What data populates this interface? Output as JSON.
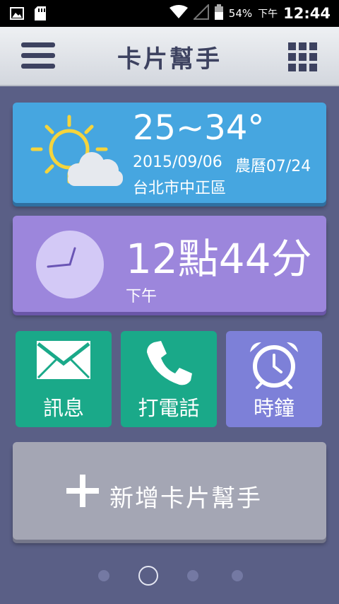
{
  "status_bar": {
    "battery": "54%",
    "ampm": "下午",
    "time": "12:44"
  },
  "header": {
    "title": "卡片幫手"
  },
  "weather": {
    "temperature": "25~34°",
    "date": "2015/09/06",
    "lunar": "農曆07/24",
    "location": "台北市中正區",
    "icon": "partly-sunny-icon"
  },
  "clock": {
    "time": "12點44分",
    "period": "下午",
    "icon": "clock-icon"
  },
  "shortcuts": [
    {
      "label": "訊息",
      "icon": "envelope-icon",
      "color": "#1aa989"
    },
    {
      "label": "打電話",
      "icon": "phone-icon",
      "color": "#1aa989"
    },
    {
      "label": "時鐘",
      "icon": "alarm-clock-icon",
      "color": "#7d80d8"
    }
  ],
  "add_card": {
    "label": "新增卡片幫手",
    "icon": "plus-icon"
  },
  "pager": {
    "total": 4,
    "active_index": 1
  },
  "colors": {
    "background": "#5a5f86",
    "weather_card": "#46a6e0",
    "clock_card": "#9c86dc",
    "shortcut_green": "#1aa989",
    "shortcut_purple": "#7d80d8",
    "add_card": "#a4a6b4",
    "header_text": "#3d4260"
  }
}
